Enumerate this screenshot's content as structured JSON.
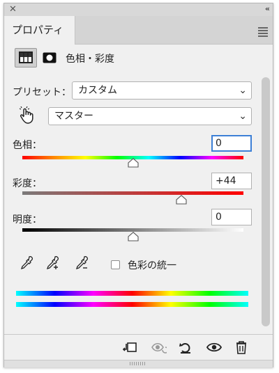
{
  "window": {
    "tab_label": "プロパティ"
  },
  "adjustment": {
    "title": "色相・彩度"
  },
  "preset": {
    "label": "プリセット：",
    "value": "カスタム"
  },
  "channel": {
    "value": "マスター"
  },
  "sliders": {
    "hue": {
      "label": "色相：",
      "value": "0",
      "position": 0.5
    },
    "saturation": {
      "label": "彩度：",
      "value": "+44",
      "position": 0.72
    },
    "lightness": {
      "label": "明度：",
      "value": "0",
      "position": 0.5
    }
  },
  "colorize": {
    "label": "色彩の統一",
    "checked": false
  },
  "icons": {
    "close": "close-icon",
    "collapse": "double-chevron-icon",
    "panel_menu": "hamburger-menu-icon",
    "adjustment_layer": "adjustment-layer-icon",
    "mask": "mask-icon",
    "targeted_adjustment": "hand-finger-icon",
    "eyedropper": "eyedropper-icon",
    "eyedropper_add": "eyedropper-plus-icon",
    "eyedropper_subtract": "eyedropper-minus-icon",
    "clip": "clip-to-layer-icon",
    "view_previous": "view-previous-state-icon",
    "reset": "reset-icon",
    "visibility": "eye-icon",
    "delete": "trash-icon"
  },
  "colors": {
    "focus_border": "#3c7fd6",
    "panel_bg": "#f0f0f0"
  }
}
